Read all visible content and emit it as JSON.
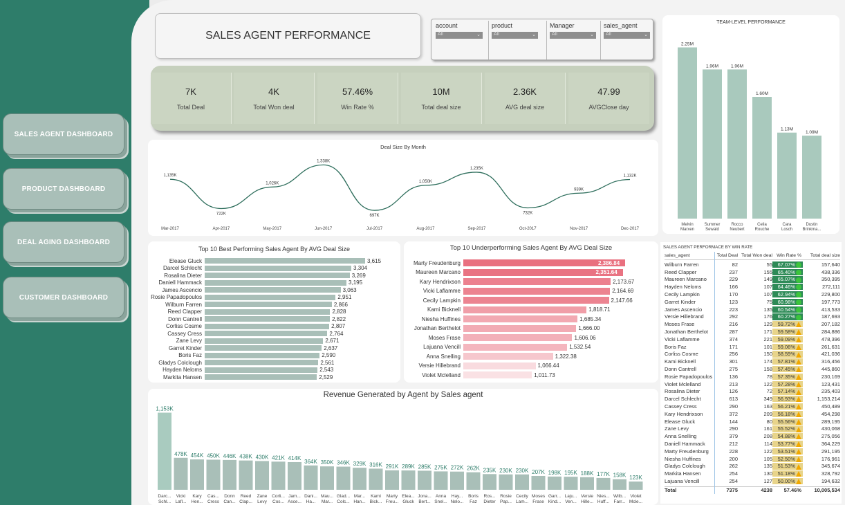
{
  "colors": {
    "sidebar": "#2e7d6a",
    "kpi_band": "#c6d0bd",
    "best_bar": "#a9bfb8",
    "under_bar": "#e9707f",
    "line": "#2e6e5c",
    "team_bar": "#a9c9bd"
  },
  "sidebar": {
    "items": [
      {
        "label": "SALES AGENT DASHBOARD"
      },
      {
        "label": "PRODUCT DASHBOARD"
      },
      {
        "label": "DEAL AGING DASHBOARD"
      },
      {
        "label": "CUSTOMER DASHBOARD"
      }
    ]
  },
  "header": {
    "title": "SALES AGENT PERFORMANCE"
  },
  "slicers": [
    {
      "label": "account",
      "value": "All"
    },
    {
      "label": "product",
      "value": "All"
    },
    {
      "label": "Manager",
      "value": "All"
    },
    {
      "label": "sales_agent",
      "value": "All"
    }
  ],
  "kpis": [
    {
      "value": "7K",
      "label": "Total Deal"
    },
    {
      "value": "4K",
      "label": "Total Won deal"
    },
    {
      "value": "57.46%",
      "label": "Win Rate %"
    },
    {
      "value": "10M",
      "label": "Total deal size"
    },
    {
      "value": "2.36K",
      "label": "AVG deal size"
    },
    {
      "value": "47.99",
      "label": "AVGClose day"
    }
  ],
  "chart_data": [
    {
      "type": "line",
      "title": "Deal Size By Month",
      "x": [
        "Mar-2017",
        "Apr-2017",
        "May-2017",
        "Jun-2017",
        "Jul-2017",
        "Aug-2017",
        "Sep-2017",
        "Oct-2017",
        "Nov-2017",
        "Dec-2017"
      ],
      "values": [
        1135,
        722,
        1026,
        1338,
        697,
        1050,
        1235,
        732,
        939,
        1132
      ],
      "labels": [
        "1,135K",
        "722K",
        "1,026K",
        "1,338K",
        "697K",
        "1,050K",
        "1,235K",
        "732K",
        "939K",
        "1,132K"
      ],
      "ylim": [
        600,
        1400
      ]
    },
    {
      "type": "bar",
      "title": "TEAM-LEVEL PERFORMANCE",
      "categories": [
        "Melvin Marxen",
        "Summer Sewald",
        "Rocco Neubert",
        "Celia Rouche",
        "Cara Losch",
        "Dustin Brinkma..."
      ],
      "values": [
        2.25,
        1.96,
        1.96,
        1.6,
        1.13,
        1.09
      ],
      "labels": [
        "2.25M",
        "1.96M",
        "1.96M",
        "1.60M",
        "1.13M",
        "1.09M"
      ],
      "ylim": [
        0,
        2.4
      ]
    },
    {
      "type": "bar",
      "title": "Top 10 Best Performing Sales Agent By AVG Deal Size",
      "categories": [
        "Elease Gluck",
        "Darcel Schlecht",
        "Rosalina Dieter",
        "Daniell Hammack",
        "James Ascencio",
        "Rosie Papadopoulos",
        "Wilburn Farren",
        "Reed Clapper",
        "Donn Cantrell",
        "Corliss Cosme",
        "Cassey Cress",
        "Zane Levy",
        "Garret Kinder",
        "Boris Faz",
        "Gladys Colclough",
        "Hayden Neloms",
        "Markita Hansen"
      ],
      "values": [
        3615,
        3304,
        3269,
        3195,
        3063,
        2951,
        2866,
        2828,
        2822,
        2807,
        2764,
        2671,
        2637,
        2590,
        2561,
        2543,
        2529
      ],
      "labels": [
        "3,615",
        "3,304",
        "3,269",
        "3,195",
        "3,063",
        "2,951",
        "2,866",
        "2,828",
        "2,822",
        "2,807",
        "2,764",
        "2,671",
        "2,637",
        "2,590",
        "2,561",
        "2,543",
        "2,529"
      ]
    },
    {
      "type": "bar",
      "title": "Top 10 Underperforming Sales Agent By AVG Deal Size",
      "categories": [
        "Marty Freudenburg",
        "Maureen Marcano",
        "Kary Hendrixson",
        "Vicki Laflamme",
        "Cecily Lampkin",
        "Kami Bicknell",
        "Niesha Huffines",
        "Jonathan Berthelot",
        "Moses Frase",
        "Lajuana Vencill",
        "Anna Snelling",
        "Versie Hillebrand",
        "Violet Mclelland"
      ],
      "values": [
        2386.84,
        2351.64,
        2173.67,
        2164.69,
        2147.66,
        1818.71,
        1685.34,
        1666.0,
        1606.06,
        1532.54,
        1322.38,
        1066.44,
        1011.73
      ],
      "labels": [
        "2,386.84",
        "2,351.64",
        "2,173.67",
        "2,164.69",
        "2,147.66",
        "1,818.71",
        "1,685.34",
        "1,666.00",
        "1,606.06",
        "1,532.54",
        "1,322.38",
        "1,066.44",
        "1,011.73"
      ]
    },
    {
      "type": "bar",
      "title": "Revenue Generated by Agent by Sales agent",
      "categories": [
        "Darc... Schl...",
        "Vicki Lafl...",
        "Kary Hen...",
        "Cas... Cress",
        "Donn Can...",
        "Reed Clap...",
        "Zane Levy",
        "Corli... Cos...",
        "Jam... Asce...",
        "Dani... Ha...",
        "Mau... Mar...",
        "Glad... Colc...",
        "Mar... Han...",
        "Kami Bick...",
        "Marty Freu...",
        "Elea... Gluck",
        "Jona... Bert...",
        "Anna Snel...",
        "Hay... Nelo...",
        "Boris Faz",
        "Ros... Dieter",
        "Rosie Pap...",
        "Cecily Lam...",
        "Moses Frase",
        "Garr... Kind...",
        "Laju... Ven...",
        "Versie Hille...",
        "Nies... Huff...",
        "Wilb... Farr...",
        "Violet Mcle..."
      ],
      "values": [
        1153,
        478,
        454,
        450,
        446,
        438,
        430,
        421,
        414,
        364,
        350,
        346,
        329,
        316,
        291,
        289,
        285,
        275,
        272,
        262,
        235,
        230,
        230,
        207,
        198,
        195,
        188,
        177,
        158,
        123
      ],
      "labels": [
        "1,153K",
        "478K",
        "454K",
        "450K",
        "446K",
        "438K",
        "430K",
        "421K",
        "414K",
        "364K",
        "350K",
        "346K",
        "329K",
        "316K",
        "291K",
        "289K",
        "285K",
        "275K",
        "272K",
        "262K",
        "235K",
        "230K",
        "230K",
        "207K",
        "198K",
        "195K",
        "188K",
        "177K",
        "158K",
        "123K"
      ]
    }
  ],
  "table": {
    "title": "SALES AGENT PERFORMACE BY WIN RATE",
    "headers": [
      "sales_agent",
      "Total Deal",
      "Total Won deal",
      "Win Rate %",
      "Total deal size"
    ],
    "rows": [
      [
        "Wilburn Farren",
        "82",
        "55",
        "67.07%",
        "157,640"
      ],
      [
        "Reed Clapper",
        "237",
        "155",
        "65.40%",
        "438,336"
      ],
      [
        "Maureen Marcano",
        "229",
        "149",
        "65.07%",
        "350,395"
      ],
      [
        "Hayden Neloms",
        "166",
        "107",
        "64.46%",
        "272,111"
      ],
      [
        "Cecily Lampkin",
        "170",
        "107",
        "62.94%",
        "229,800"
      ],
      [
        "Garret Kinder",
        "123",
        "75",
        "60.98%",
        "197,773"
      ],
      [
        "James Ascencio",
        "223",
        "135",
        "60.54%",
        "413,533"
      ],
      [
        "Versie Hillebrand",
        "292",
        "176",
        "60.27%",
        "187,693"
      ],
      [
        "Moses Frase",
        "216",
        "129",
        "59.72%",
        "207,182"
      ],
      [
        "Jonathan Berthelot",
        "287",
        "171",
        "59.58%",
        "284,886"
      ],
      [
        "Vicki Laflamme",
        "374",
        "221",
        "59.09%",
        "478,396"
      ],
      [
        "Boris Faz",
        "171",
        "101",
        "59.06%",
        "261,631"
      ],
      [
        "Corliss Cosme",
        "256",
        "150",
        "58.59%",
        "421,036"
      ],
      [
        "Kami Bicknell",
        "301",
        "174",
        "57.81%",
        "316,456"
      ],
      [
        "Donn Cantrell",
        "275",
        "158",
        "57.45%",
        "445,860"
      ],
      [
        "Rosie Papadopoulos",
        "136",
        "78",
        "57.35%",
        "230,169"
      ],
      [
        "Violet Mclelland",
        "213",
        "122",
        "57.28%",
        "123,431"
      ],
      [
        "Rosalina Dieter",
        "126",
        "72",
        "57.14%",
        "235,403"
      ],
      [
        "Darcel Schlecht",
        "613",
        "349",
        "56.93%",
        "1,153,214"
      ],
      [
        "Cassey Cress",
        "290",
        "163",
        "56.21%",
        "450,489"
      ],
      [
        "Kary Hendrixson",
        "372",
        "209",
        "56.18%",
        "454,298"
      ],
      [
        "Elease Gluck",
        "144",
        "80",
        "55.56%",
        "289,195"
      ],
      [
        "Zane Levy",
        "290",
        "161",
        "55.52%",
        "430,068"
      ],
      [
        "Anna Snelling",
        "379",
        "208",
        "54.88%",
        "275,056"
      ],
      [
        "Daniell Hammack",
        "212",
        "114",
        "53.77%",
        "364,229"
      ],
      [
        "Marty Freudenburg",
        "228",
        "122",
        "53.51%",
        "291,195"
      ],
      [
        "Niesha Huffines",
        "200",
        "105",
        "52.50%",
        "176,961"
      ],
      [
        "Gladys Colclough",
        "262",
        "135",
        "51.53%",
        "345,674"
      ],
      [
        "Markita Hansen",
        "254",
        "130",
        "51.18%",
        "328,792"
      ],
      [
        "Lajuana Vencill",
        "254",
        "127",
        "50.00%",
        "194,632"
      ]
    ],
    "total": [
      "Total",
      "7375",
      "4238",
      "57.46%",
      "10,005,534"
    ]
  }
}
